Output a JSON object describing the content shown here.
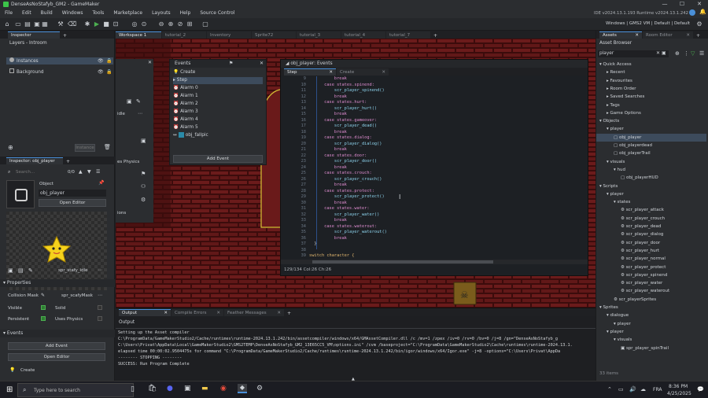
{
  "window": {
    "title": "DenseAsNoStafyb_GM2 - GameMaker",
    "ide_version": "IDE v2024.13.1.193 Runtime v2024.13.1.242",
    "target": "Windows | GMS2 VM | Default | Default"
  },
  "menu": [
    "File",
    "Edit",
    "Build",
    "Windows",
    "Tools",
    "Marketplace",
    "Layouts",
    "Help",
    "Source Control"
  ],
  "workspace_tabs": [
    "Workspace 1",
    "tutorial_2",
    "Inventory",
    "Sprite72",
    "tutorial_3",
    "tutorial_4",
    "tutorial_7"
  ],
  "inspector": {
    "tab": "Inspector",
    "layers_title": "Layers - Introom",
    "layers": [
      "Instances",
      "Background"
    ],
    "instances_label": "Instance",
    "object_inspector_title": "Inspector: obj_player",
    "count": "0/0",
    "object_header": "Object",
    "object_name": "obj_player",
    "open_editor": "Open Editor",
    "sprite_name": "spr_stafy_idle",
    "properties": "Properties",
    "collision_mask_label": "Collision Mask",
    "collision_mask_value": "spr_scafyMask",
    "visible": "Visible",
    "solid": "Solid",
    "persistent": "Persistent",
    "uses_physics": "Uses Physics",
    "events_label": "Events",
    "add_event": "Add Event",
    "open_editor2": "Open Editor",
    "create": "Create",
    "search_placeholder": "Search..."
  },
  "room_panel": {
    "sprite_label": "idle",
    "physics_label": "es Physics",
    "ions": "ions"
  },
  "events": {
    "title": "Events",
    "items": [
      "Create",
      "Step",
      "Alarm 0",
      "Alarm 1",
      "Alarm 2",
      "Alarm 3",
      "Alarm 4",
      "Alarm 5",
      "obj_fallpic"
    ],
    "add_event": "Add Event"
  },
  "code_editor": {
    "title": "obj_player: Events",
    "tabs": [
      "Step",
      "Create"
    ],
    "status": "129/134 Col:26 Ch:26",
    "lines": [
      {
        "n": "9",
        "t": "          break"
      },
      {
        "n": "10",
        "t": "      case states.spinend:"
      },
      {
        "n": "11",
        "t": "          scr_player_spinend()"
      },
      {
        "n": "12",
        "t": "          break"
      },
      {
        "n": "13",
        "t": "      case states.hurt:"
      },
      {
        "n": "14",
        "t": "          scr_player_hurt()"
      },
      {
        "n": "15",
        "t": "          break"
      },
      {
        "n": "16",
        "t": "      case states.gameover:"
      },
      {
        "n": "17",
        "t": "          scr_player_dead()"
      },
      {
        "n": "18",
        "t": "          break"
      },
      {
        "n": "19",
        "t": "      case states.dialog:"
      },
      {
        "n": "20",
        "t": "          scr_player_dialog()"
      },
      {
        "n": "21",
        "t": "          break"
      },
      {
        "n": "22",
        "t": "      case states.door:"
      },
      {
        "n": "23",
        "t": "          scr_player_door()"
      },
      {
        "n": "24",
        "t": "          break"
      },
      {
        "n": "25",
        "t": "      case states.crouch:"
      },
      {
        "n": "26",
        "t": "          scr_player_crouch()"
      },
      {
        "n": "27",
        "t": "          break"
      },
      {
        "n": "28",
        "t": "      case states.protect:"
      },
      {
        "n": "29",
        "t": "          scr_player_protect()"
      },
      {
        "n": "30",
        "t": "          break"
      },
      {
        "n": "31",
        "t": "      case states.water:"
      },
      {
        "n": "32",
        "t": "          scr_player_water()"
      },
      {
        "n": "33",
        "t": "          break"
      },
      {
        "n": "34",
        "t": "      case states.waterout:"
      },
      {
        "n": "35",
        "t": "          scr_player_waterout()"
      },
      {
        "n": "36",
        "t": "          break"
      },
      {
        "n": "37",
        "t": "  }"
      },
      {
        "n": "38",
        "t": ""
      },
      {
        "n": "39",
        "t": "switch character {"
      }
    ]
  },
  "output": {
    "tabs": [
      "Output",
      "Compile Errors",
      "Feather Messages"
    ],
    "header": "Output",
    "lines": [
      "Setting up the Asset compiler",
      "C:\\ProgramData/GameMakerStudio2/Cache/runtimes\\runtime-2024.13.1.242/bin/assetcompiler/windows/x64/GMAssetCompiler.dll  /c /mv=1 /zpex /iv=0 /rv=0 /bv=0 /j=8  /gn=\"DenseAsNoStafyb_g",
      "C:\\Users\\Privat\\AppData\\Local\\GameMakerStudio2\\GMS2TEMP\\DenseAsNoStafyb_GM2_13E65CC5_VM\\options.ini\"  /cvm /baseproject=\"C:\\ProgramData\\GameMakerStudio2\\Cache\\runtimes\\runtime-2024.13.1.",
      "elapsed time 00:00:02.9504475s for command \"C:\\ProgramData/GameMakerStudio2/Cache/runtimes\\runtime-2024.13.1.242/bin/igor/windows/x64/Igor.exe\" -j=8  -options=\"C:\\Users\\Privat\\AppDa",
      "-------- STOPPING --------",
      "SUCCESS: Run Program Complete"
    ]
  },
  "assets": {
    "tabs": [
      "Assets",
      "Room Editor"
    ],
    "browser_title": "Asset Browser",
    "search_value": "player",
    "items": [
      {
        "label": "Quick Access",
        "d": 0
      },
      {
        "label": "Recent",
        "d": 1
      },
      {
        "label": "Favourites",
        "d": 1
      },
      {
        "label": "Room Order",
        "d": 1
      },
      {
        "label": "Saved Searches",
        "d": 1
      },
      {
        "label": "Tags",
        "d": 1
      },
      {
        "label": "Game Options",
        "d": 1
      },
      {
        "label": "Objects",
        "d": 0
      },
      {
        "label": "player",
        "d": 1
      },
      {
        "label": "obj_player",
        "d": 2
      },
      {
        "label": "obj_playerdead",
        "d": 2
      },
      {
        "label": "obj_playerTrail",
        "d": 2
      },
      {
        "label": "visuals",
        "d": 1
      },
      {
        "label": "hud",
        "d": 2
      },
      {
        "label": "obj_playerHUD",
        "d": 3
      },
      {
        "label": "Scripts",
        "d": 0
      },
      {
        "label": "player",
        "d": 1
      },
      {
        "label": "states",
        "d": 2
      },
      {
        "label": "scr_player_attack",
        "d": 3
      },
      {
        "label": "scr_player_crouch",
        "d": 3
      },
      {
        "label": "scr_player_dead",
        "d": 3
      },
      {
        "label": "scr_player_dialog",
        "d": 3
      },
      {
        "label": "scr_player_door",
        "d": 3
      },
      {
        "label": "scr_player_hurt",
        "d": 3
      },
      {
        "label": "scr_player_normal",
        "d": 3
      },
      {
        "label": "scr_player_protect",
        "d": 3
      },
      {
        "label": "scr_player_spinend",
        "d": 3
      },
      {
        "label": "scr_player_water",
        "d": 3
      },
      {
        "label": "scr_player_waterout",
        "d": 3
      },
      {
        "label": "scr_playerSprites",
        "d": 2
      },
      {
        "label": "Sprites",
        "d": 0
      },
      {
        "label": "dialogue",
        "d": 1
      },
      {
        "label": "player",
        "d": 2
      },
      {
        "label": "player",
        "d": 1
      },
      {
        "label": "visuals",
        "d": 2
      },
      {
        "label": "spr_player_spinTrail",
        "d": 3
      }
    ],
    "footer": "33 items"
  },
  "taskbar": {
    "search_placeholder": "Type here to search",
    "time": "8:36 PM",
    "date": "4/25/2025",
    "lang": "FRA"
  },
  "colors": {
    "accent": "#4a90d9",
    "editor_bg": "#1a1d21",
    "success": "#4caf50"
  }
}
